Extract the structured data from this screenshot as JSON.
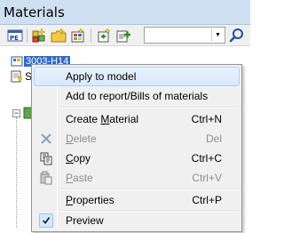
{
  "window": {
    "title": "Materials"
  },
  "toolbar": {
    "buttons": [
      "properties-button",
      "new-material-button",
      "new-folder-button",
      "import-button",
      "add-button",
      "add-to-report-button"
    ],
    "combo_value": "",
    "search_icon": "search-icon"
  },
  "tree": {
    "selected_node_label": "3003-H14",
    "second_node_label": "S",
    "expander_symbol": "−"
  },
  "context_menu": {
    "items": [
      {
        "label": "Apply to model",
        "shortcut": "",
        "enabled": true,
        "highlighted": true,
        "icon": ""
      },
      {
        "label": "Add to report/Bills of materials",
        "shortcut": "",
        "enabled": true,
        "icon": ""
      },
      {
        "label_pre": "Create ",
        "label_key": "M",
        "label_post": "aterial",
        "shortcut": "Ctrl+N",
        "enabled": true,
        "icon": ""
      },
      {
        "label_pre": "",
        "label_key": "D",
        "label_post": "elete",
        "shortcut": "Del",
        "enabled": false,
        "icon": "delete-x-icon"
      },
      {
        "label_pre": "",
        "label_key": "C",
        "label_post": "opy",
        "shortcut": "Ctrl+C",
        "enabled": true,
        "icon": "copy-icon"
      },
      {
        "label_pre": "",
        "label_key": "P",
        "label_post": "aste",
        "shortcut": "Ctrl+V",
        "enabled": false,
        "icon": "paste-icon"
      },
      {
        "label_pre": "",
        "label_key": "P",
        "label_post": "roperties",
        "shortcut": "Ctrl+P",
        "enabled": true,
        "icon": ""
      },
      {
        "label": "Preview",
        "shortcut": "",
        "enabled": true,
        "checked": true,
        "icon": "checkmark-icon"
      }
    ]
  },
  "colors": {
    "selection": "#3169c6",
    "title_bar": "#cfe0f3",
    "menu_bg": "#f0f0f0"
  }
}
